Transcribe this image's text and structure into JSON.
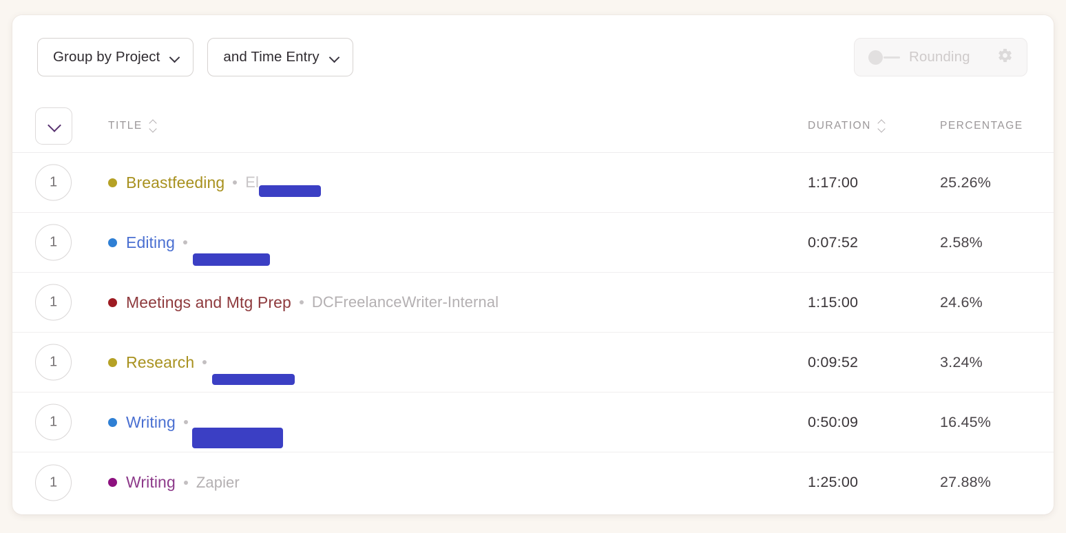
{
  "toolbar": {
    "group_by": "Group by Project",
    "and_by": "and Time Entry",
    "rounding_label": "Rounding",
    "rounding_enabled": false
  },
  "table": {
    "headers": {
      "title": "TITLE",
      "duration": "DURATION",
      "percentage": "PERCENTAGE"
    },
    "rows": [
      {
        "count": "1",
        "dot_color": "#b5a125",
        "name": "Breastfeeding",
        "name_color": "#a8911f",
        "subtitle": "El",
        "subtitle_redacted": true,
        "duration": "1:17:00",
        "percentage": "25.26%"
      },
      {
        "count": "1",
        "dot_color": "#2f7fd4",
        "name": "Editing",
        "name_color": "#4a6fd1",
        "subtitle": "",
        "subtitle_redacted": true,
        "duration": "0:07:52",
        "percentage": "2.58%"
      },
      {
        "count": "1",
        "dot_color": "#9d1b22",
        "name": "Meetings and Mtg Prep",
        "name_color": "#8e3a3d",
        "subtitle": "DCFreelanceWriter-Internal",
        "subtitle_redacted": false,
        "duration": "1:15:00",
        "percentage": "24.6%"
      },
      {
        "count": "1",
        "dot_color": "#b5a125",
        "name": "Research",
        "name_color": "#a8911f",
        "subtitle": "",
        "subtitle_redacted": true,
        "duration": "0:09:52",
        "percentage": "3.24%"
      },
      {
        "count": "1",
        "dot_color": "#2f7fd4",
        "name": "Writing",
        "name_color": "#4a6fd1",
        "subtitle": "",
        "subtitle_redacted": true,
        "duration": "0:50:09",
        "percentage": "16.45%"
      },
      {
        "count": "1",
        "dot_color": "#8d117f",
        "name": "Writing",
        "name_color": "#8d3a8a",
        "subtitle": "Zapier",
        "subtitle_redacted": false,
        "duration": "1:25:00",
        "percentage": "27.88%"
      }
    ]
  },
  "colors": {
    "page_background": "#faf6f1",
    "card_background": "#ffffff",
    "accent_purple": "#57306f",
    "redaction": "#3b3fc4"
  }
}
